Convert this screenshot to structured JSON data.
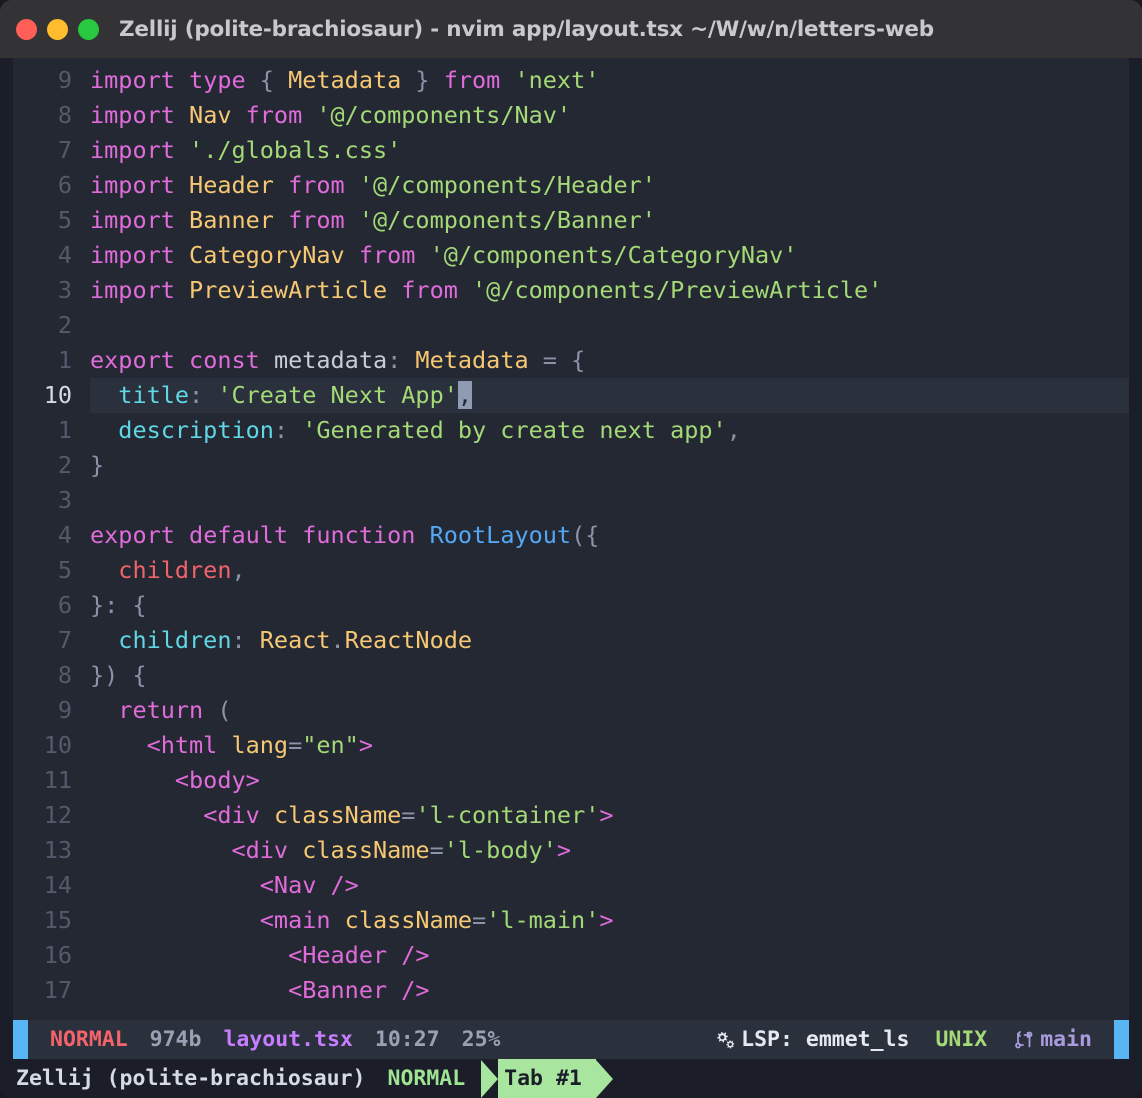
{
  "window": {
    "title": "Zellij (polite-brachiosaur) - nvim app/layout.tsx ~/W/w/n/letters-web",
    "traffic_lights": [
      "close",
      "minimize",
      "maximize"
    ]
  },
  "editor": {
    "lines": [
      {
        "num": "9",
        "current": false,
        "tokens": [
          {
            "t": "import ",
            "c": "kw"
          },
          {
            "t": "type ",
            "c": "kw"
          },
          {
            "t": "{ ",
            "c": "pun"
          },
          {
            "t": "Metadata",
            "c": "id"
          },
          {
            "t": " } ",
            "c": "pun"
          },
          {
            "t": "from ",
            "c": "kw"
          },
          {
            "t": "'next'",
            "c": "str"
          }
        ]
      },
      {
        "num": "8",
        "current": false,
        "tokens": [
          {
            "t": "import ",
            "c": "kw"
          },
          {
            "t": "Nav ",
            "c": "id"
          },
          {
            "t": "from ",
            "c": "kw"
          },
          {
            "t": "'@/components/Nav'",
            "c": "str"
          }
        ]
      },
      {
        "num": "7",
        "current": false,
        "tokens": [
          {
            "t": "import ",
            "c": "kw"
          },
          {
            "t": "'./globals.css'",
            "c": "str"
          }
        ]
      },
      {
        "num": "6",
        "current": false,
        "tokens": [
          {
            "t": "import ",
            "c": "kw"
          },
          {
            "t": "Header ",
            "c": "id"
          },
          {
            "t": "from ",
            "c": "kw"
          },
          {
            "t": "'@/components/Header'",
            "c": "str"
          }
        ]
      },
      {
        "num": "5",
        "current": false,
        "tokens": [
          {
            "t": "import ",
            "c": "kw"
          },
          {
            "t": "Banner ",
            "c": "id"
          },
          {
            "t": "from ",
            "c": "kw"
          },
          {
            "t": "'@/components/Banner'",
            "c": "str"
          }
        ]
      },
      {
        "num": "4",
        "current": false,
        "tokens": [
          {
            "t": "import ",
            "c": "kw"
          },
          {
            "t": "CategoryNav ",
            "c": "id"
          },
          {
            "t": "from ",
            "c": "kw"
          },
          {
            "t": "'@/components/CategoryNav'",
            "c": "str"
          }
        ]
      },
      {
        "num": "3",
        "current": false,
        "tokens": [
          {
            "t": "import ",
            "c": "kw"
          },
          {
            "t": "PreviewArticle ",
            "c": "id"
          },
          {
            "t": "from ",
            "c": "kw"
          },
          {
            "t": "'@/components/PreviewArticle'",
            "c": "str"
          }
        ]
      },
      {
        "num": "2",
        "current": false,
        "tokens": []
      },
      {
        "num": "1",
        "current": false,
        "tokens": [
          {
            "t": "export ",
            "c": "kw"
          },
          {
            "t": "const ",
            "c": "kw"
          },
          {
            "t": "metadata",
            "c": "var"
          },
          {
            "t": ": ",
            "c": "pun"
          },
          {
            "t": "Metadata",
            "c": "id"
          },
          {
            "t": " ",
            "c": "pun"
          },
          {
            "t": "= ",
            "c": "pun"
          },
          {
            "t": "{",
            "c": "pun"
          }
        ]
      },
      {
        "num": "10",
        "current": true,
        "tokens": [
          {
            "t": "  ",
            "c": "pun"
          },
          {
            "t": "title",
            "c": "prop"
          },
          {
            "t": ": ",
            "c": "pun"
          },
          {
            "t": "'Create Next App'",
            "c": "str"
          },
          {
            "t": ",",
            "c": "cursor"
          }
        ]
      },
      {
        "num": "1",
        "current": false,
        "tokens": [
          {
            "t": "  ",
            "c": "pun"
          },
          {
            "t": "description",
            "c": "prop"
          },
          {
            "t": ": ",
            "c": "pun"
          },
          {
            "t": "'Generated by create next app'",
            "c": "str"
          },
          {
            "t": ",",
            "c": "pun"
          }
        ]
      },
      {
        "num": "2",
        "current": false,
        "tokens": [
          {
            "t": "}",
            "c": "pun"
          }
        ]
      },
      {
        "num": "3",
        "current": false,
        "tokens": []
      },
      {
        "num": "4",
        "current": false,
        "tokens": [
          {
            "t": "export ",
            "c": "kw"
          },
          {
            "t": "default ",
            "c": "kw"
          },
          {
            "t": "function ",
            "c": "kw"
          },
          {
            "t": "RootLayout",
            "c": "fn"
          },
          {
            "t": "({",
            "c": "pun"
          }
        ]
      },
      {
        "num": "5",
        "current": false,
        "tokens": [
          {
            "t": "  ",
            "c": "pun"
          },
          {
            "t": "children",
            "c": "par"
          },
          {
            "t": ",",
            "c": "pun"
          }
        ]
      },
      {
        "num": "6",
        "current": false,
        "tokens": [
          {
            "t": "}: {",
            "c": "pun"
          }
        ]
      },
      {
        "num": "7",
        "current": false,
        "tokens": [
          {
            "t": "  ",
            "c": "pun"
          },
          {
            "t": "children",
            "c": "prop"
          },
          {
            "t": ": ",
            "c": "pun"
          },
          {
            "t": "React",
            "c": "id"
          },
          {
            "t": ".",
            "c": "pun"
          },
          {
            "t": "ReactNode",
            "c": "id"
          }
        ]
      },
      {
        "num": "8",
        "current": false,
        "tokens": [
          {
            "t": "}) {",
            "c": "pun"
          }
        ]
      },
      {
        "num": "9",
        "current": false,
        "tokens": [
          {
            "t": "  ",
            "c": "pun"
          },
          {
            "t": "return ",
            "c": "kw"
          },
          {
            "t": "(",
            "c": "pun"
          }
        ]
      },
      {
        "num": "10",
        "current": false,
        "tokens": [
          {
            "t": "    ",
            "c": "pun"
          },
          {
            "t": "<html ",
            "c": "tag"
          },
          {
            "t": "lang",
            "c": "attr"
          },
          {
            "t": "=",
            "c": "pun"
          },
          {
            "t": "\"en\"",
            "c": "str"
          },
          {
            "t": ">",
            "c": "tag"
          }
        ]
      },
      {
        "num": "11",
        "current": false,
        "tokens": [
          {
            "t": "      ",
            "c": "pun"
          },
          {
            "t": "<body>",
            "c": "tag"
          }
        ]
      },
      {
        "num": "12",
        "current": false,
        "tokens": [
          {
            "t": "        ",
            "c": "pun"
          },
          {
            "t": "<div ",
            "c": "tag"
          },
          {
            "t": "className",
            "c": "attr"
          },
          {
            "t": "=",
            "c": "pun"
          },
          {
            "t": "'l-container'",
            "c": "str"
          },
          {
            "t": ">",
            "c": "tag"
          }
        ]
      },
      {
        "num": "13",
        "current": false,
        "tokens": [
          {
            "t": "          ",
            "c": "pun"
          },
          {
            "t": "<div ",
            "c": "tag"
          },
          {
            "t": "className",
            "c": "attr"
          },
          {
            "t": "=",
            "c": "pun"
          },
          {
            "t": "'l-body'",
            "c": "str"
          },
          {
            "t": ">",
            "c": "tag"
          }
        ]
      },
      {
        "num": "14",
        "current": false,
        "tokens": [
          {
            "t": "            ",
            "c": "pun"
          },
          {
            "t": "<Nav />",
            "c": "tag"
          }
        ]
      },
      {
        "num": "15",
        "current": false,
        "tokens": [
          {
            "t": "            ",
            "c": "pun"
          },
          {
            "t": "<main ",
            "c": "tag"
          },
          {
            "t": "className",
            "c": "attr"
          },
          {
            "t": "=",
            "c": "pun"
          },
          {
            "t": "'l-main'",
            "c": "str"
          },
          {
            "t": ">",
            "c": "tag"
          }
        ]
      },
      {
        "num": "16",
        "current": false,
        "tokens": [
          {
            "t": "              ",
            "c": "pun"
          },
          {
            "t": "<Header />",
            "c": "tag"
          }
        ]
      },
      {
        "num": "17",
        "current": false,
        "tokens": [
          {
            "t": "              ",
            "c": "pun"
          },
          {
            "t": "<Banner />",
            "c": "tag"
          }
        ]
      }
    ]
  },
  "statusline": {
    "mode": "NORMAL",
    "filesize": "974b",
    "filename": "layout.tsx",
    "position": "10:27",
    "percent": "25%",
    "lsp_icon": "gears-icon",
    "lsp": "LSP: emmet_ls",
    "fileformat": "UNIX",
    "branch_icon": "git-branch-icon",
    "branch": "main"
  },
  "zellij": {
    "session": "Zellij (polite-brachiosaur)",
    "mode": "NORMAL",
    "tab": "Tab #1"
  },
  "colors": {
    "titlebar_bg": "#333336",
    "editor_bg": "#242832",
    "gutter_edge": "#1b1e28",
    "statusline_bg": "#2b303d",
    "statusline_accent": "#58b6f5",
    "zellij_bg": "#1b1e28",
    "tab_active": "#a8e6a0",
    "cursor": "#8f9bb3",
    "keyword": "#e06bdb",
    "string": "#a3d977",
    "type": "#f7c873",
    "property": "#5fd7e4",
    "function": "#53a7f5",
    "parameter": "#f2636a"
  }
}
